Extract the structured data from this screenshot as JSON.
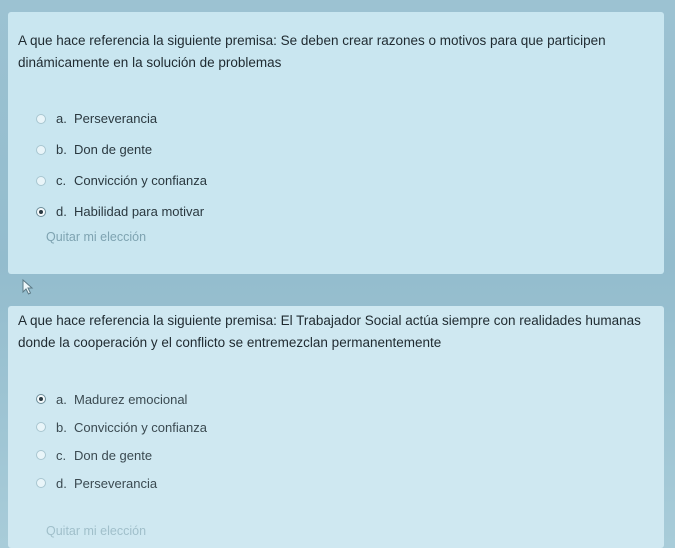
{
  "questions": [
    {
      "text": "A que hace referencia la siguiente premisa: Se deben crear razones o motivos para que participen dinámicamente en la solución de problemas",
      "answers": [
        {
          "letter": "a.",
          "text": "Perseverancia",
          "selected": false
        },
        {
          "letter": "b.",
          "text": "Don de gente",
          "selected": false
        },
        {
          "letter": "c.",
          "text": "Convicción y confianza",
          "selected": false
        },
        {
          "letter": "d.",
          "text": "Habilidad para motivar",
          "selected": true
        }
      ],
      "clear_label": "Quitar mi elección"
    },
    {
      "text": "A que hace referencia la siguiente premisa: El Trabajador Social actúa siempre con realidades humanas donde la cooperación y el conflicto se entremezclan permanentemente",
      "answers": [
        {
          "letter": "a.",
          "text": "Madurez emocional",
          "selected": true
        },
        {
          "letter": "b.",
          "text": "Convicción y confianza",
          "selected": false
        },
        {
          "letter": "c.",
          "text": "Don de gente",
          "selected": false
        },
        {
          "letter": "d.",
          "text": "Perseverancia",
          "selected": false
        }
      ],
      "clear_label": "Quitar mi elección"
    }
  ],
  "icons": {
    "cursor": "mouse-pointer-icon"
  },
  "colors": {
    "card_background": "#c9e6f0",
    "page_background": "#93bccd",
    "clear_link": "#7ea3b1"
  }
}
